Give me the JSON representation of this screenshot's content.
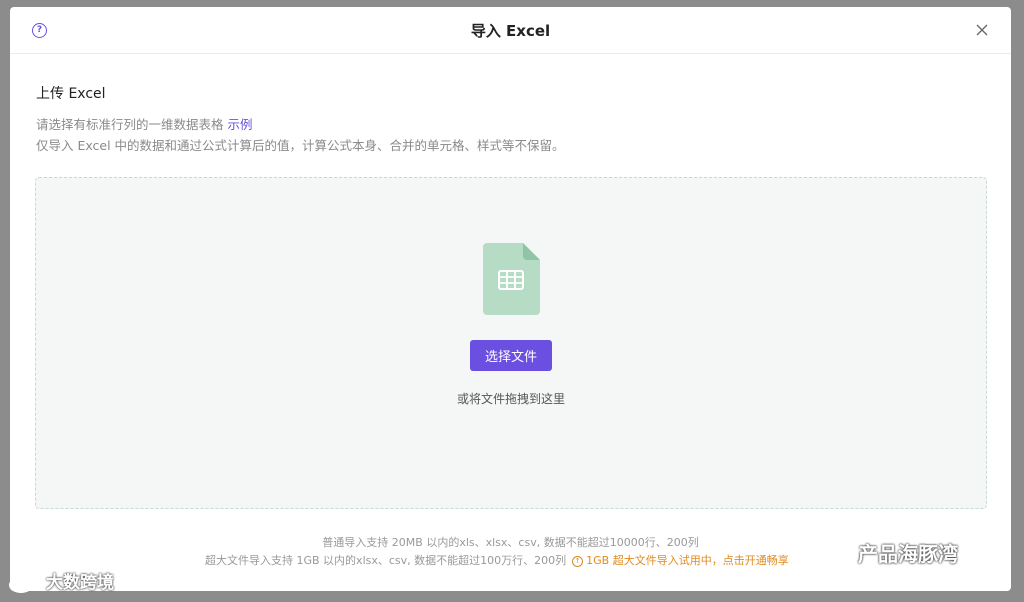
{
  "header": {
    "title": "导入 Excel",
    "help_icon": "question-circle-icon",
    "close_icon": "close-icon"
  },
  "upload": {
    "section_title": "上传 Excel",
    "desc_line1": "请选择有标准行列的一维数据表格",
    "example_link": "示例",
    "desc_line2": "仅导入 Excel 中的数据和通过公式计算后的值，计算公式本身、合并的单元格、样式等不保留。"
  },
  "dropzone": {
    "file_icon": "spreadsheet-file-icon",
    "choose_button": "选择文件",
    "drag_hint": "或将文件拖拽到这里"
  },
  "notes": {
    "line1": "普通导入支持 20MB 以内的xls、xlsx、csv, 数据不能超过10000行、200列",
    "line2": "超大文件导入支持 1GB 以内的xlsx、csv, 数据不能超过100万行、200列",
    "trial_link": "1GB 超大文件导入试用中，点击开通畅享"
  },
  "watermarks": {
    "right": "产品海豚湾",
    "left": "大数跨境"
  },
  "colors": {
    "accent": "#6b4fe0",
    "dropzone_bg": "#f4f7f6",
    "file_icon": "#b7dcc6",
    "trial": "#e08a1e"
  }
}
